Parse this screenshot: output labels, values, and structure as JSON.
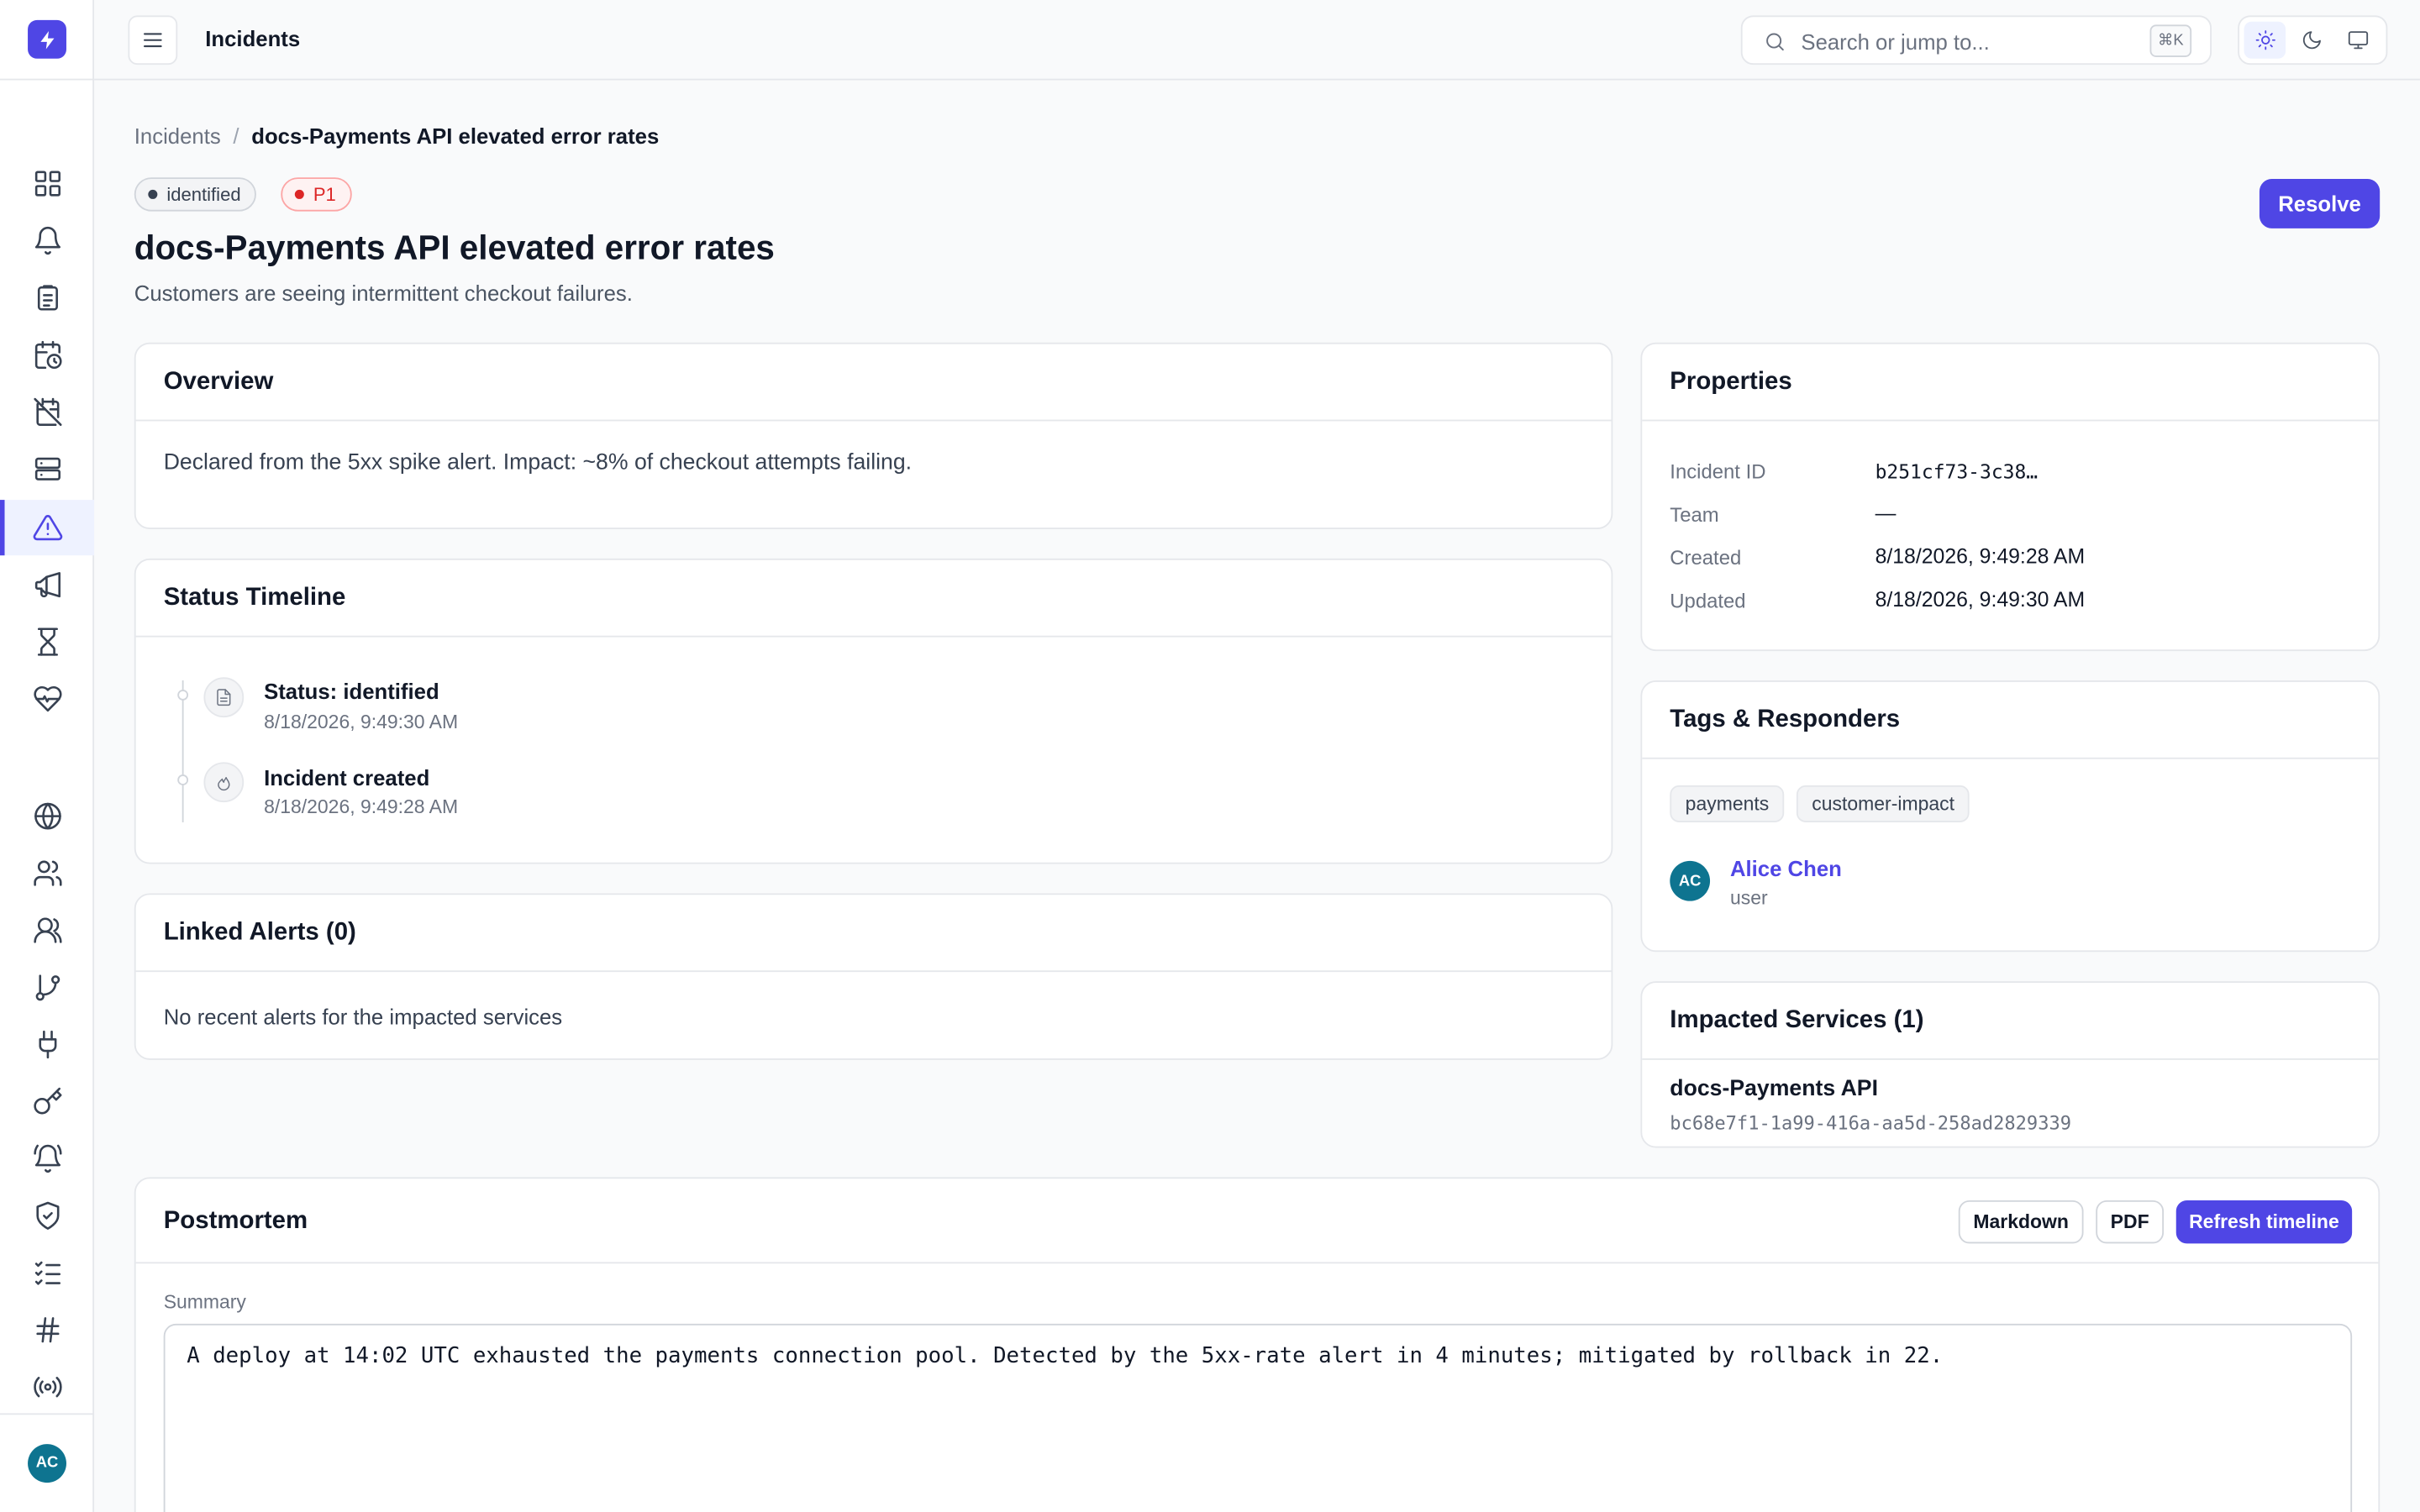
{
  "topbar": {
    "title": "Incidents",
    "search_placeholder": "Search or jump to...",
    "search_shortcut": "⌘K"
  },
  "sidebar": {
    "user_initials": "AC",
    "nav_icons": [
      "dashboard-icon",
      "bell-icon",
      "clipboard-icon",
      "calendar-clock-icon",
      "calendar-off-icon",
      "server-icon",
      "alert-triangle-icon",
      "megaphone-icon",
      "hourglass-icon",
      "heart-pulse-icon",
      "globe-icon",
      "users-icon",
      "team-icon",
      "git-branch-icon",
      "plug-icon",
      "key-icon",
      "bell-ring-icon",
      "shield-icon",
      "checklist-icon",
      "hash-icon",
      "broadcast-icon"
    ],
    "active_item": "alert-triangle-icon"
  },
  "breadcrumb": {
    "parent": "Incidents",
    "separator": "/",
    "current": "docs-Payments API elevated error rates"
  },
  "incident": {
    "status": "identified",
    "severity": "P1",
    "title": "docs-Payments API elevated error rates",
    "description": "Customers are seeing intermittent checkout failures.",
    "resolve_label": "Resolve"
  },
  "overview": {
    "title": "Overview",
    "text": "Declared from the 5xx spike alert. Impact: ~8% of checkout attempts failing."
  },
  "timeline": {
    "title": "Status Timeline",
    "events": [
      {
        "title": "Status: identified",
        "time": "8/18/2026, 9:49:30 AM",
        "icon": "document-icon"
      },
      {
        "title": "Incident created",
        "time": "8/18/2026, 9:49:28 AM",
        "icon": "flame-icon"
      }
    ]
  },
  "linked_alerts": {
    "title": "Linked Alerts (0)",
    "empty": "No recent alerts for the impacted services"
  },
  "properties": {
    "title": "Properties",
    "rows": [
      {
        "label": "Incident ID",
        "value": "b251cf73-3c38…"
      },
      {
        "label": "Team",
        "value": "—"
      },
      {
        "label": "Created",
        "value": "8/18/2026, 9:49:28 AM"
      },
      {
        "label": "Updated",
        "value": "8/18/2026, 9:49:30 AM"
      }
    ]
  },
  "tags_responders": {
    "title": "Tags & Responders",
    "tags": [
      "payments",
      "customer-impact"
    ],
    "responder": {
      "initials": "AC",
      "name": "Alice Chen",
      "role": "user"
    }
  },
  "impacted_services": {
    "title": "Impacted Services (1)",
    "services": [
      {
        "name": "docs-Payments API",
        "id": "bc68e7f1-1a99-416a-aa5d-258ad2829339"
      }
    ]
  },
  "postmortem": {
    "title": "Postmortem",
    "buttons": {
      "markdown": "Markdown",
      "pdf": "PDF",
      "refresh": "Refresh timeline"
    },
    "summary_label": "Summary",
    "summary_text": "A deploy at 14:02 UTC exhausted the payments connection pool. Detected by the 5xx-rate alert in 4 minutes; mitigated by rollback in 22."
  },
  "colors": {
    "accent": "#4f46e5",
    "severity": "#dc2626",
    "avatar": "#0e7490"
  }
}
